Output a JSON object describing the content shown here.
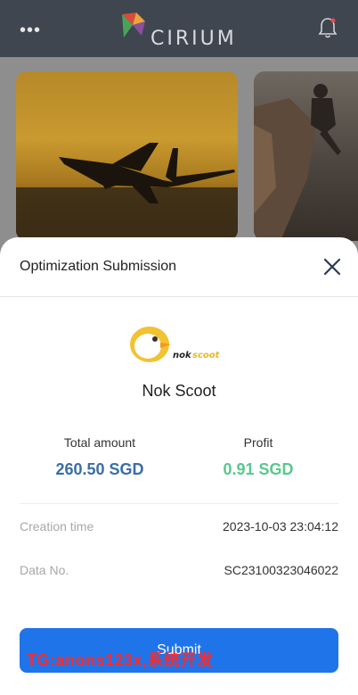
{
  "header": {
    "app_name": "CIRIUM",
    "menu_glyph": "•••",
    "icons": {
      "menu": "more-dots-icon",
      "notifications": "bell-icon"
    },
    "colors": {
      "bar": "#3f4650",
      "logo_red": "#d94b3b",
      "logo_green": "#4aa35a",
      "logo_purple": "#8a4f9e",
      "badge": "#e84a4a"
    }
  },
  "modal": {
    "title": "Optimization Submission",
    "close_icon": "close-icon",
    "company_name": "Nok Scoot",
    "total_amount_label": "Total amount",
    "total_amount_value": "260.50 SGD",
    "profit_label": "Profit",
    "profit_value": "0.91 SGD",
    "creation_time_label": "Creation time",
    "creation_time_value": "2023-10-03 23:04:12",
    "data_no_label": "Data No.",
    "data_no_value": "SC23100323046022",
    "submit_label": "Submit",
    "colors": {
      "amount": "#3a6ea5",
      "profit": "#5bc78f",
      "submit": "#1f74ea"
    }
  },
  "watermark": "TG:anons123x,系统开发"
}
